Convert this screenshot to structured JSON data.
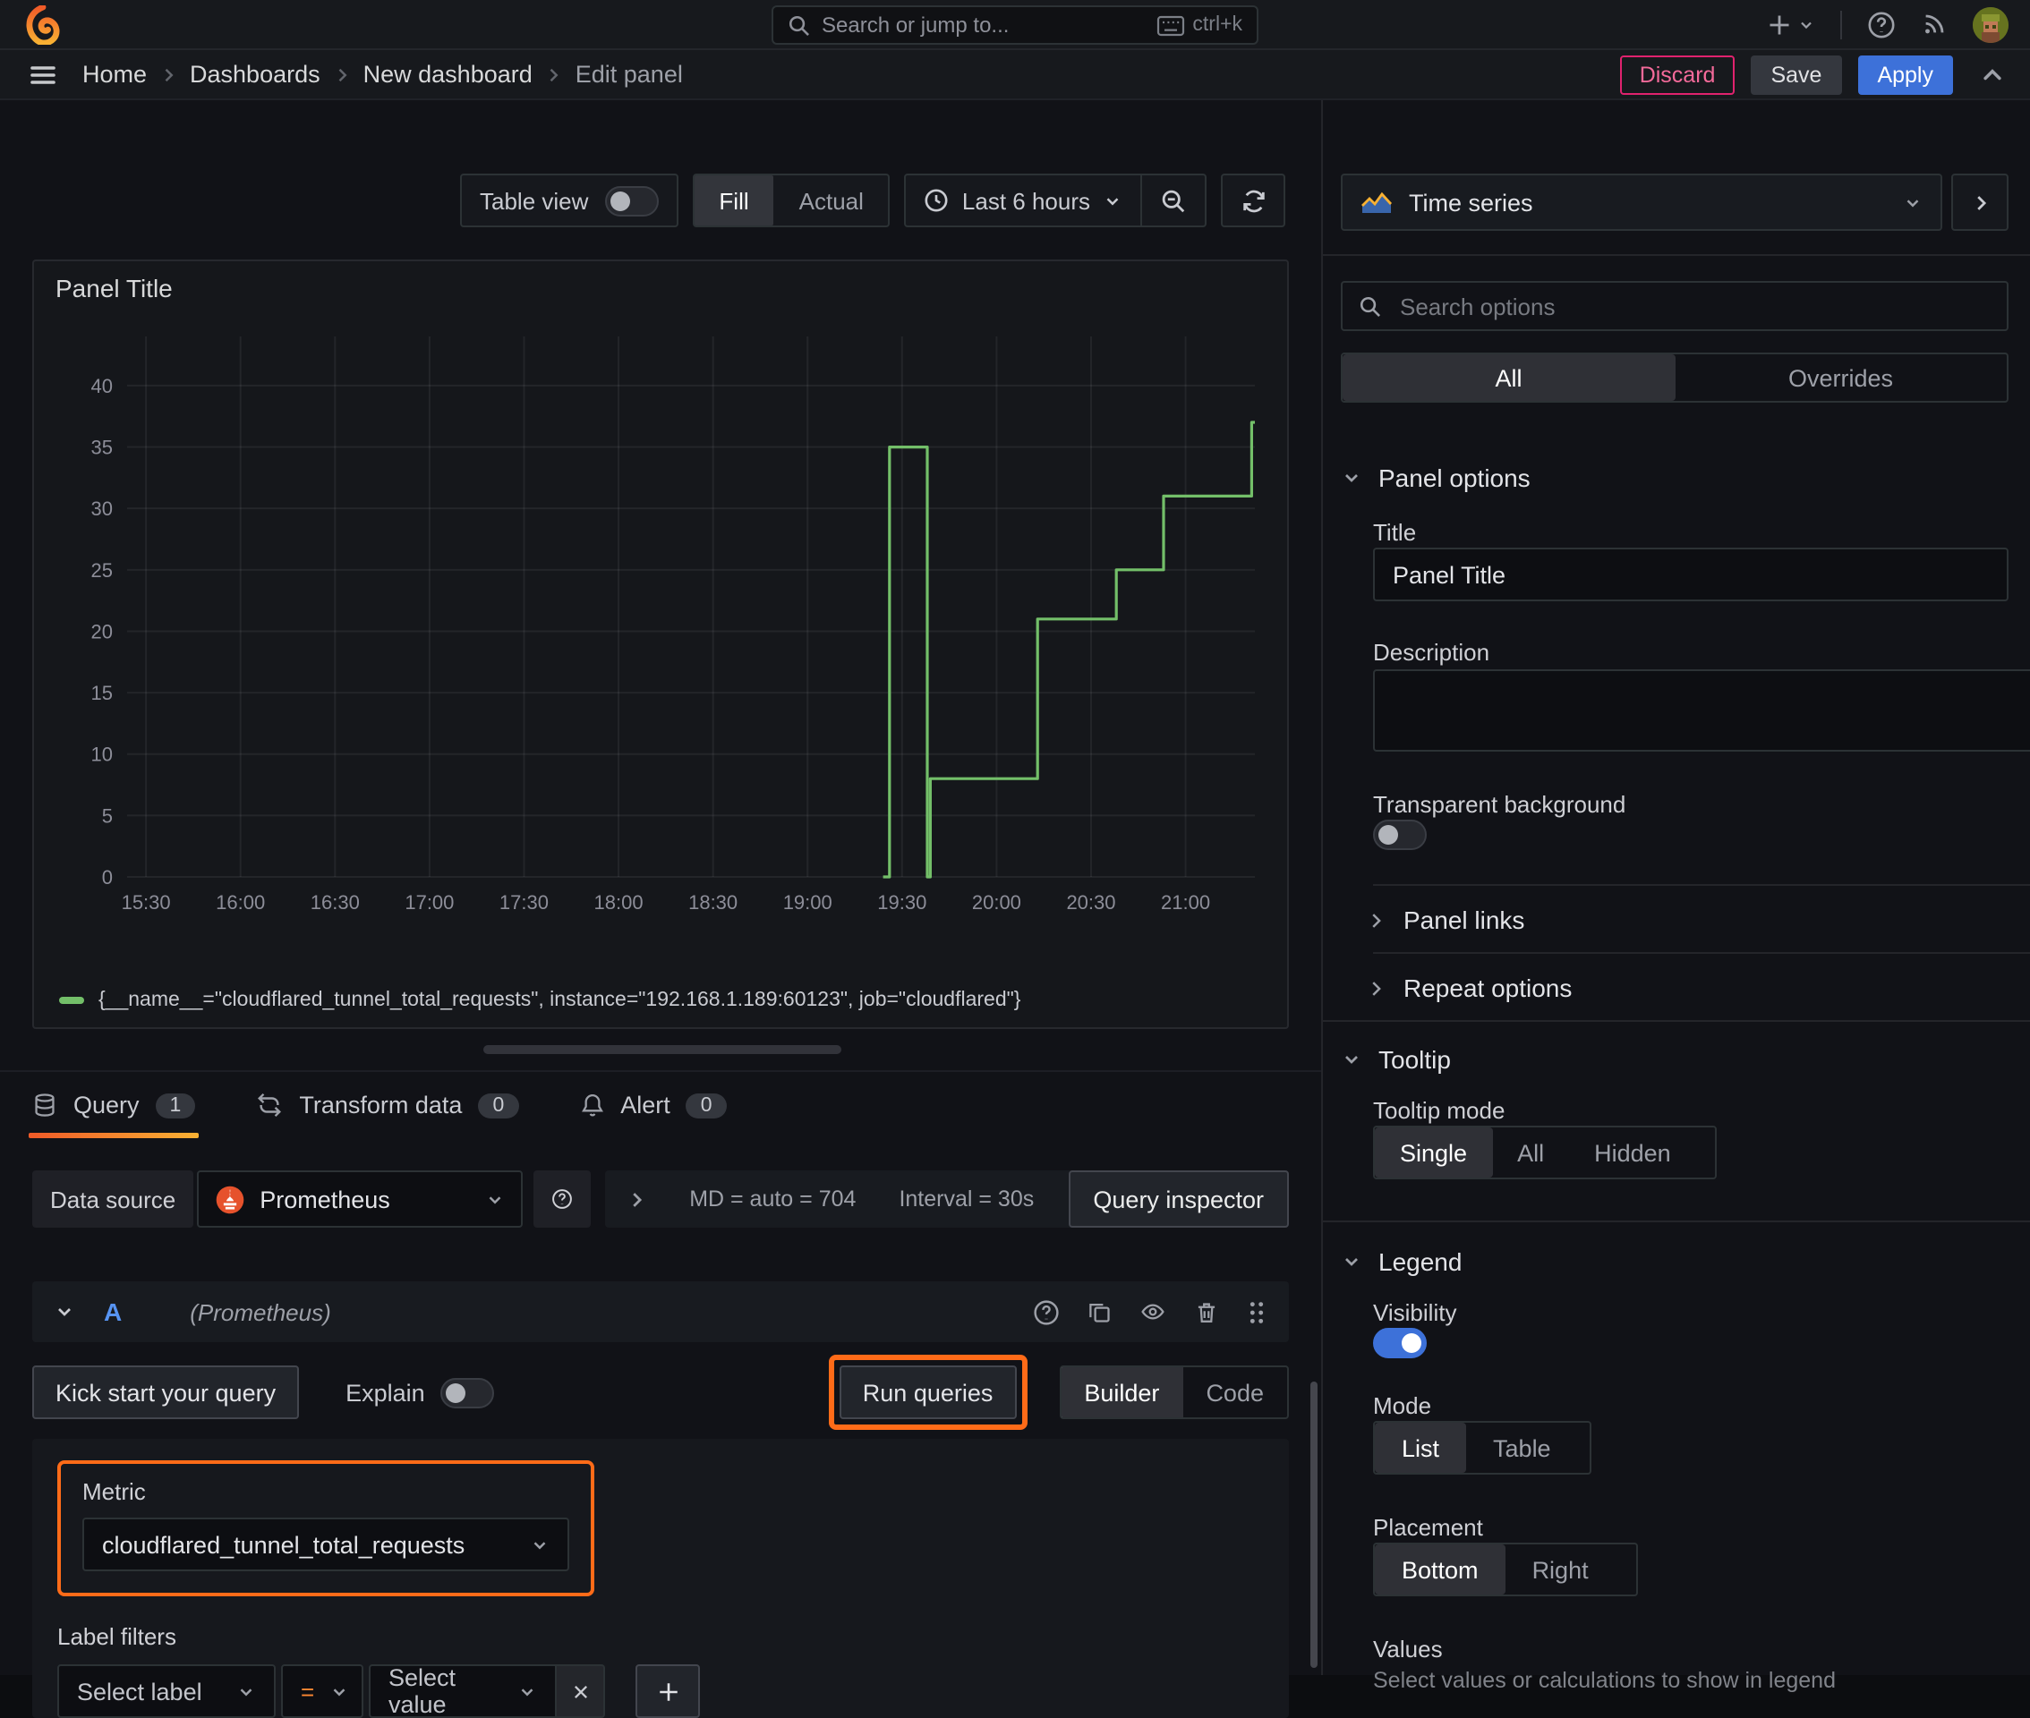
{
  "colors": {
    "accent_orange": "#ff6b18",
    "blue": "#3d71d9",
    "green": "#73bf69",
    "discard_pink": "#e0226e"
  },
  "topnav": {
    "search_placeholder": "Search or jump to...",
    "search_shortcut": "ctrl+k"
  },
  "breadcrumb": {
    "items": [
      "Home",
      "Dashboards",
      "New dashboard",
      "Edit panel"
    ],
    "discard_label": "Discard",
    "save_label": "Save",
    "apply_label": "Apply"
  },
  "toolbar": {
    "table_view_label": "Table view",
    "fill_label": "Fill",
    "actual_label": "Actual",
    "time_range_label": "Last 6 hours"
  },
  "panel": {
    "title": "Panel Title"
  },
  "chart_data": {
    "type": "line",
    "line_style": "step-after",
    "color": "#73bf69",
    "title": "Panel Title",
    "xlabel": "",
    "ylabel": "",
    "grid": true,
    "legend_position": "bottom",
    "legend": [
      {
        "color": "#73bf69",
        "label": "{__name__=\"cloudflared_tunnel_total_requests\", instance=\"192.168.1.189:60123\", job=\"cloudflared\"}"
      }
    ],
    "x_ticks": [
      "15:30",
      "16:00",
      "16:30",
      "17:00",
      "17:30",
      "18:00",
      "18:30",
      "19:00",
      "19:30",
      "20:00",
      "20:30",
      "21:00"
    ],
    "y_ticks": [
      0,
      5,
      10,
      15,
      20,
      25,
      30,
      35,
      40
    ],
    "ylim": [
      0,
      44
    ],
    "x_range": [
      "15:24",
      "21:22"
    ],
    "points": [
      {
        "time": "19:24",
        "value": 0
      },
      {
        "time": "19:26",
        "value": 35
      },
      {
        "time": "19:38",
        "value": 0
      },
      {
        "time": "19:39",
        "value": 8
      },
      {
        "time": "20:13",
        "value": 21
      },
      {
        "time": "20:38",
        "value": 25
      },
      {
        "time": "20:53",
        "value": 31
      },
      {
        "time": "21:21",
        "value": 37
      },
      {
        "time": "21:22",
        "value": 37
      }
    ]
  },
  "tabs": {
    "query_label": "Query",
    "query_count": "1",
    "transform_label": "Transform data",
    "transform_count": "0",
    "alert_label": "Alert",
    "alert_count": "0"
  },
  "datasource": {
    "label": "Data source",
    "name": "Prometheus",
    "stats_md": "MD = auto = 704",
    "stats_interval": "Interval = 30s",
    "inspector_label": "Query inspector"
  },
  "query_editor": {
    "ref_id": "A",
    "ds_hint": "(Prometheus)",
    "kick_start_label": "Kick start your query",
    "explain_label": "Explain",
    "run_queries_label": "Run queries",
    "builder_label": "Builder",
    "code_label": "Code",
    "metric_label": "Metric",
    "metric_value": "cloudflared_tunnel_total_requests",
    "label_filters_label": "Label filters",
    "select_label_placeholder": "Select label",
    "operator": "=",
    "select_value_placeholder": "Select value"
  },
  "sidebar": {
    "viz_type": "Time series",
    "search_placeholder": "Search options",
    "filter_tabs": [
      "All",
      "Overrides"
    ],
    "panel_options": {
      "heading": "Panel options",
      "title_label": "Title",
      "title_value": "Panel Title",
      "description_label": "Description",
      "transparent_label": "Transparent background"
    },
    "links_label": "Panel links",
    "repeat_label": "Repeat options",
    "tooltip": {
      "heading": "Tooltip",
      "mode_label": "Tooltip mode",
      "options": [
        "Single",
        "All",
        "Hidden"
      ],
      "selected": "Single"
    },
    "legend": {
      "heading": "Legend",
      "visibility_label": "Visibility",
      "mode_label": "Mode",
      "mode_options": [
        "List",
        "Table"
      ],
      "mode_selected": "List",
      "placement_label": "Placement",
      "placement_options": [
        "Bottom",
        "Right"
      ],
      "placement_selected": "Bottom",
      "values_label": "Values",
      "values_help": "Select values or calculations to show in legend"
    }
  }
}
